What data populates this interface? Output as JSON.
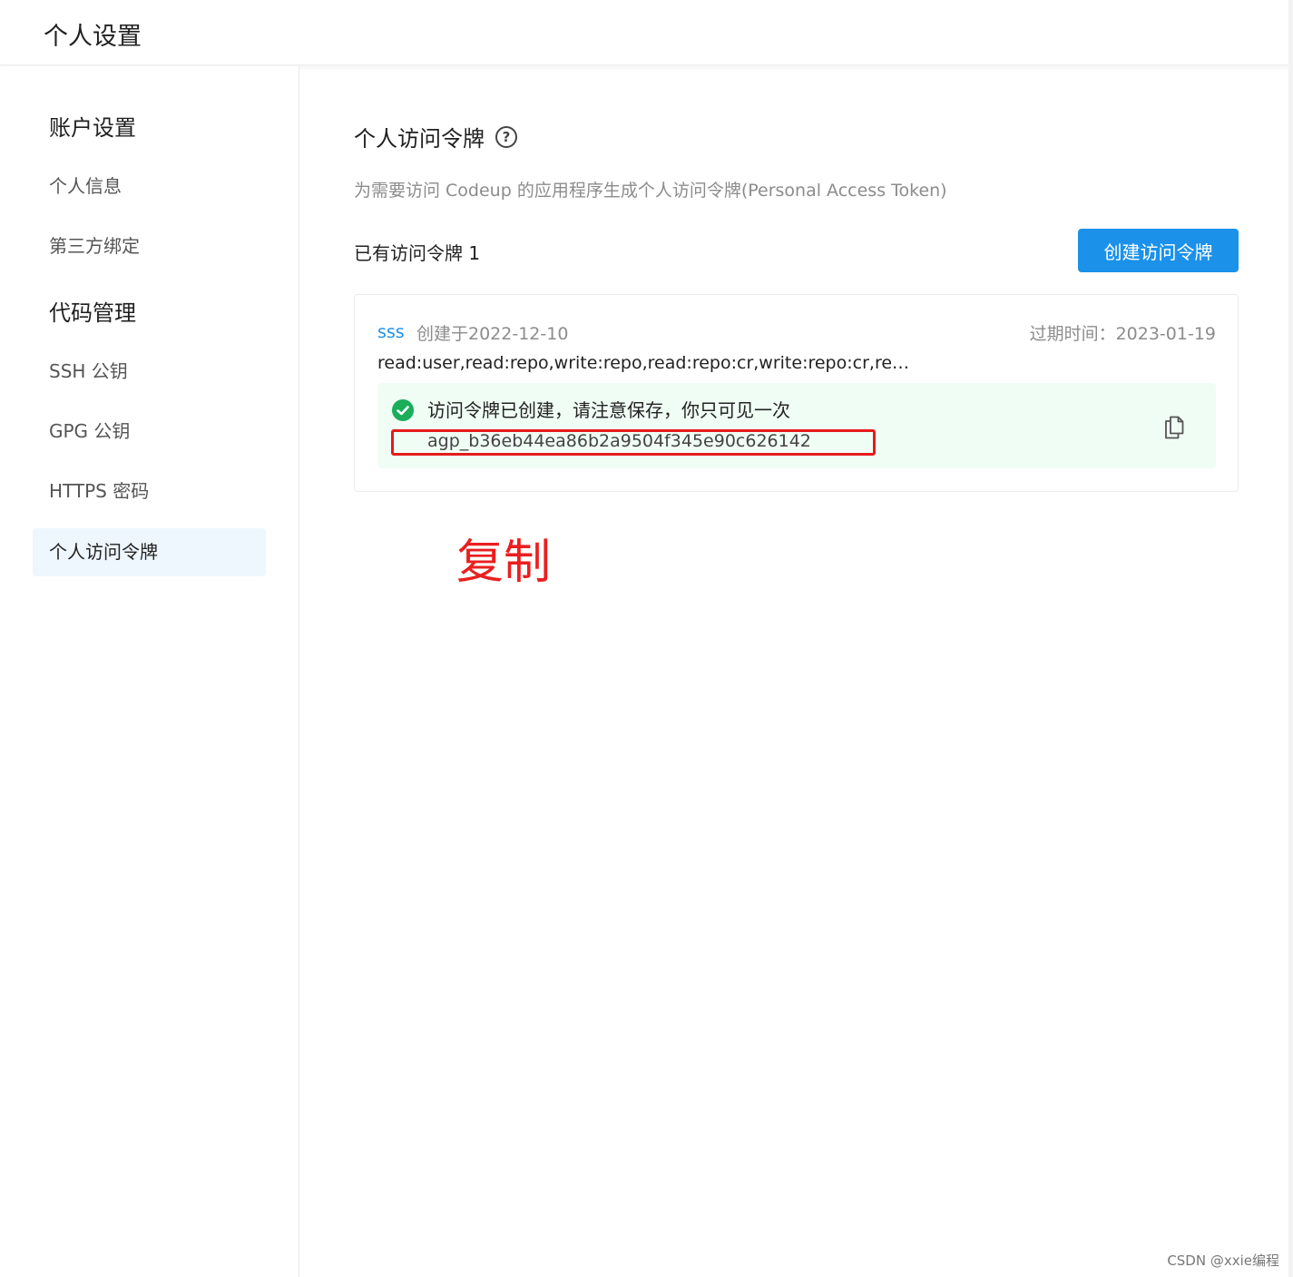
{
  "header": {
    "title": "个人设置"
  },
  "sidebar": {
    "sections": [
      {
        "title": "账户设置",
        "items": [
          "个人信息",
          "第三方绑定"
        ]
      },
      {
        "title": "代码管理",
        "items": [
          "SSH 公钥",
          "GPG 公钥",
          "HTTPS 密码",
          "个人访问令牌"
        ]
      }
    ],
    "active_item": "个人访问令牌"
  },
  "main": {
    "heading": "个人访问令牌",
    "help_icon": "question-circle-icon",
    "description": "为需要访问 Codeup 的应用程序生成个人访问令牌(Personal Access Token)",
    "count_label": "已有访问令牌 1",
    "create_button_label": "创建访问令牌",
    "token": {
      "name": "sss",
      "created": "创建于2022-12-10",
      "expires": "过期时间：2023-01-19",
      "scopes": "read:user,read:repo,write:repo,read:repo:cr,write:repo:cr,re…",
      "success_message": "访问令牌已创建，请注意保存，你只可见一次",
      "value": "agp_b36eb44ea86b2a9504f345e90c626142",
      "copy_icon": "copy-icon"
    }
  },
  "annotation": {
    "text": "复制",
    "color": "#ea1f1f"
  },
  "watermark": "CSDN @xxie编程",
  "colors": {
    "accent": "#1b91ea",
    "success": "#1aad5a",
    "success_bg": "#f0fdf5",
    "active_nav_bg": "#eef6fe"
  }
}
